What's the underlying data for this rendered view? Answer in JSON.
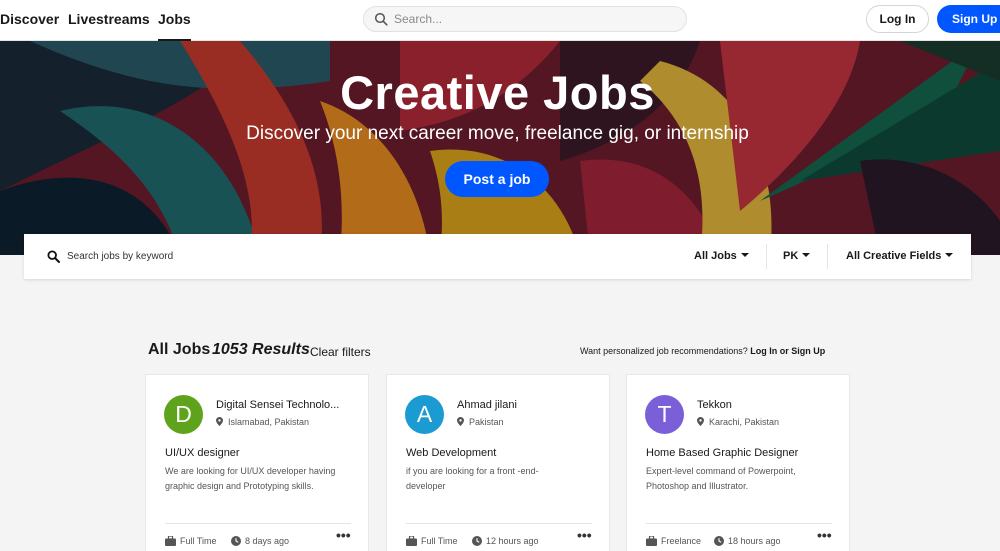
{
  "nav": {
    "links": [
      "Discover",
      "Livestreams",
      "Jobs"
    ],
    "search_placeholder": "Search...",
    "login": "Log In",
    "signup": "Sign Up"
  },
  "hero": {
    "title": "Creative Jobs",
    "subtitle": "Discover your next career move, freelance gig, or internship",
    "post_button": "Post a job"
  },
  "filters": {
    "search_placeholder": "Search jobs by keyword",
    "job_type": "All Jobs",
    "country": "PK",
    "fields": "All Creative Fields"
  },
  "results": {
    "title": "All Jobs",
    "count": "1053 Results",
    "clear": "Clear filters",
    "recommend_text": "Want personalized job recommendations?",
    "recommend_link": "Log In or Sign Up"
  },
  "cards": [
    {
      "initial": "D",
      "color": "#5ea31b",
      "company": "Digital Sensei Technolo...",
      "location": "Islamabad, Pakistan",
      "title": "UI/UX designer",
      "desc": "We are looking for UI/UX developer having graphic design and Prototyping skills.",
      "type": "Full Time",
      "time": "8 days ago"
    },
    {
      "initial": "A",
      "color": "#1b9bd1",
      "company": "Ahmad jilani",
      "location": "Pakistan",
      "title": "Web Development",
      "desc": "if you are looking for a front -end-developer",
      "type": "Full Time",
      "time": "12 hours ago"
    },
    {
      "initial": "T",
      "color": "#7b5fd9",
      "company": "Tekkon",
      "location": "Karachi, Pakistan",
      "title": "Home Based Graphic Designer",
      "desc": "Expert-level command of Powerpoint, Photoshop and Illustrator.",
      "type": "Freelance",
      "time": "18 hours ago"
    }
  ]
}
